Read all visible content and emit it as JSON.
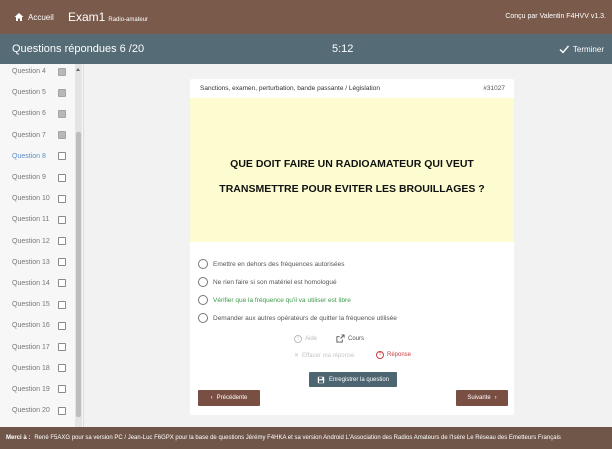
{
  "topbar": {
    "home_label": "Accueil",
    "app_name": "Exam1",
    "app_subtitle": "Radio-amateur",
    "author": "Conçu par Valentin F4HVV  v1.3."
  },
  "status": {
    "answered": "Questions répondues 6 /20",
    "timer": "5:12",
    "finish_label": "Terminer"
  },
  "sidebar": {
    "items": [
      {
        "label": "Question 4",
        "done": true
      },
      {
        "label": "Question 5",
        "done": true
      },
      {
        "label": "Question 6",
        "done": true
      },
      {
        "label": "Question 7",
        "done": true
      },
      {
        "label": "Question 8",
        "done": false,
        "current": true
      },
      {
        "label": "Question 9",
        "done": false
      },
      {
        "label": "Question 10",
        "done": false
      },
      {
        "label": "Question 11",
        "done": false
      },
      {
        "label": "Question 12",
        "done": false
      },
      {
        "label": "Question 13",
        "done": false
      },
      {
        "label": "Question 14",
        "done": false
      },
      {
        "label": "Question 15",
        "done": false
      },
      {
        "label": "Question 16",
        "done": false
      },
      {
        "label": "Question 17",
        "done": false
      },
      {
        "label": "Question 18",
        "done": false
      },
      {
        "label": "Question 19",
        "done": false
      },
      {
        "label": "Question 20",
        "done": false
      }
    ]
  },
  "question": {
    "category": "Sanctions, examen, perturbation, bande passante / Législation",
    "number": "#31027",
    "text_line1": "QUE DOIT FAIRE UN RADIOAMATEUR QUI VEUT",
    "text_line2": "TRANSMETTRE POUR EVITER LES BROUILLAGES ?",
    "answers": [
      {
        "text": "Emettre en dehors des fréquences autorisées",
        "correct": false
      },
      {
        "text": "Ne rien faire si son matériel est homologué",
        "correct": false
      },
      {
        "text": "Vérifier que la fréquence qu'il va utiliser est libre",
        "correct": true
      },
      {
        "text": "Demander aux autres opérateurs de quitter la fréquence utilisée",
        "correct": false
      }
    ]
  },
  "tools": {
    "aide": "Aide",
    "cours": "Cours",
    "effacer": "Effacer ma réponse",
    "reponse": "Réponse"
  },
  "buttons": {
    "save": "Enregistrer la question",
    "prev": "Précédente",
    "next": "Suivante"
  },
  "footer": {
    "thanks": "Merci à :",
    "text": "René F5AXG pour sa version PC / Jean-Luc F6GPX pour la base de questions  Jérémy F4HKA et sa version Android   L'Association des Radios Amateurs de l'Isère   Le Réseau des Emetteurs Français"
  },
  "colors": {
    "topbar": "#7a5a4b",
    "statusbar": "#556b75",
    "question_bg": "#fdfbd0",
    "correct_answer": "#3e9a4a",
    "nav_button": "#7a4f43",
    "save_button": "#4d6571"
  }
}
